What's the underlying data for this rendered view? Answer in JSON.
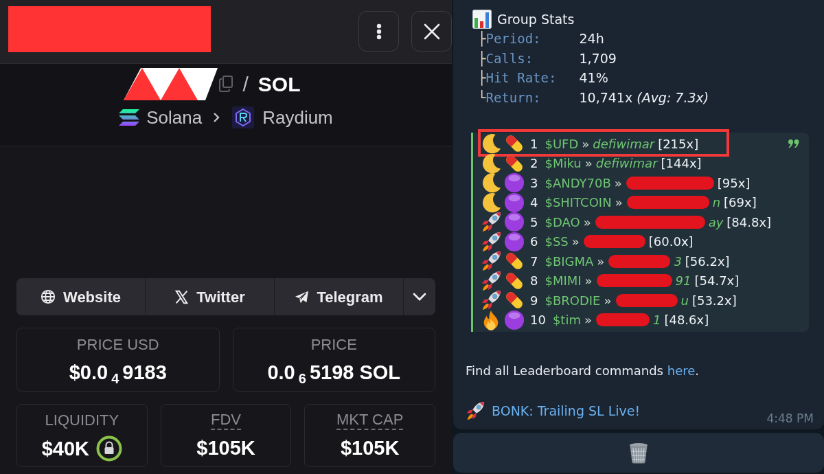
{
  "token": {
    "pair": {
      "separator": "/",
      "quote": "SOL"
    },
    "route": {
      "chain": "Solana",
      "dex": "Raydium"
    },
    "links": [
      {
        "kind": "website",
        "label": "Website"
      },
      {
        "kind": "twitter",
        "label": "Twitter"
      },
      {
        "kind": "telegram",
        "label": "Telegram"
      }
    ],
    "price_cards": [
      {
        "label": "PRICE USD",
        "value": "$0.0$_{4}$9183"
      },
      {
        "label": "PRICE",
        "value": "0.0$_{6}$5198 SOL"
      }
    ],
    "metric_cards": [
      {
        "label": "LIQUIDITY",
        "value": "$40K",
        "locked": true,
        "underlined": false
      },
      {
        "label": "FDV",
        "value": "$105K",
        "locked": false,
        "underlined": true
      },
      {
        "label": "MKT CAP",
        "value": "$105K",
        "locked": false,
        "underlined": true
      }
    ]
  },
  "message": {
    "title": "Group Stats",
    "stats": [
      {
        "branch": "├",
        "label": "Period:",
        "value": "24h"
      },
      {
        "branch": "├",
        "label": "Calls:",
        "value": "1,709"
      },
      {
        "branch": "├",
        "label": "Hit Rate:",
        "value": "41%"
      },
      {
        "branch": "└",
        "label": "Return:",
        "value": "10,741x *(Avg: 7.3x)*"
      }
    ],
    "leaderboard": [
      {
        "icons": [
          {
            "kind": "moon"
          },
          {
            "kind": "pill"
          }
        ],
        "rank": "1",
        "ticker": "$UFD",
        "separator": "»",
        "caller": "defiwimar",
        "redacted": false,
        "multiplier": "[215x]",
        "highlighted": true
      },
      {
        "icons": [
          {
            "kind": "moon"
          },
          {
            "kind": "pill"
          }
        ],
        "rank": "2",
        "ticker": "$Miku",
        "separator": "»",
        "caller": "defiwimar",
        "redacted": false,
        "multiplier": "[144x]",
        "highlighted": false
      },
      {
        "icons": [
          {
            "kind": "moon"
          },
          {
            "kind": "circle"
          }
        ],
        "rank": "3",
        "ticker": "$ANDY70B",
        "separator": "»",
        "redacted": true,
        "multiplier": "[95x]",
        "highlighted": false
      },
      {
        "icons": [
          {
            "kind": "moon"
          },
          {
            "kind": "circle"
          }
        ],
        "rank": "4",
        "ticker": "$SHITCOIN",
        "separator": "»",
        "caller": "n",
        "redacted": true,
        "multiplier": "[69x]",
        "highlighted": false
      },
      {
        "icons": [
          {
            "kind": "rocket"
          },
          {
            "kind": "circle"
          }
        ],
        "rank": "5",
        "ticker": "$DAO",
        "separator": "»",
        "caller": "ay",
        "redacted": true,
        "multiplier": "[84.8x]",
        "highlighted": false
      },
      {
        "icons": [
          {
            "kind": "rocket"
          },
          {
            "kind": "circle"
          }
        ],
        "rank": "6",
        "ticker": "$SS",
        "separator": "»",
        "redacted": true,
        "multiplier": "[60.0x]",
        "highlighted": false
      },
      {
        "icons": [
          {
            "kind": "rocket"
          },
          {
            "kind": "pill"
          }
        ],
        "rank": "7",
        "ticker": "$BIGMA",
        "separator": "»",
        "caller": "3",
        "redacted": true,
        "multiplier": "[56.2x]",
        "highlighted": false
      },
      {
        "icons": [
          {
            "kind": "rocket"
          },
          {
            "kind": "pill"
          }
        ],
        "rank": "8",
        "ticker": "$MIMI",
        "separator": "»",
        "caller": "91",
        "redacted": true,
        "multiplier": "[54.7x]",
        "highlighted": false
      },
      {
        "icons": [
          {
            "kind": "rocket"
          },
          {
            "kind": "pill"
          }
        ],
        "rank": "9",
        "ticker": "$BRODIE",
        "separator": "»",
        "caller": "u",
        "redacted": true,
        "multiplier": "[53.2x]",
        "highlighted": false
      },
      {
        "icons": [
          {
            "kind": "fire"
          },
          {
            "kind": "circle"
          }
        ],
        "rank": "10",
        "ticker": "$tim",
        "separator": "»",
        "caller": "1",
        "redacted": true,
        "multiplier": "[48.6x]",
        "highlighted": false
      }
    ],
    "footer": {
      "text": "Find all Leaderboard commands ",
      "link": "here",
      "end": "."
    },
    "announcement": "BONK: Trailing SL Live!",
    "time": "4:48 PM"
  }
}
